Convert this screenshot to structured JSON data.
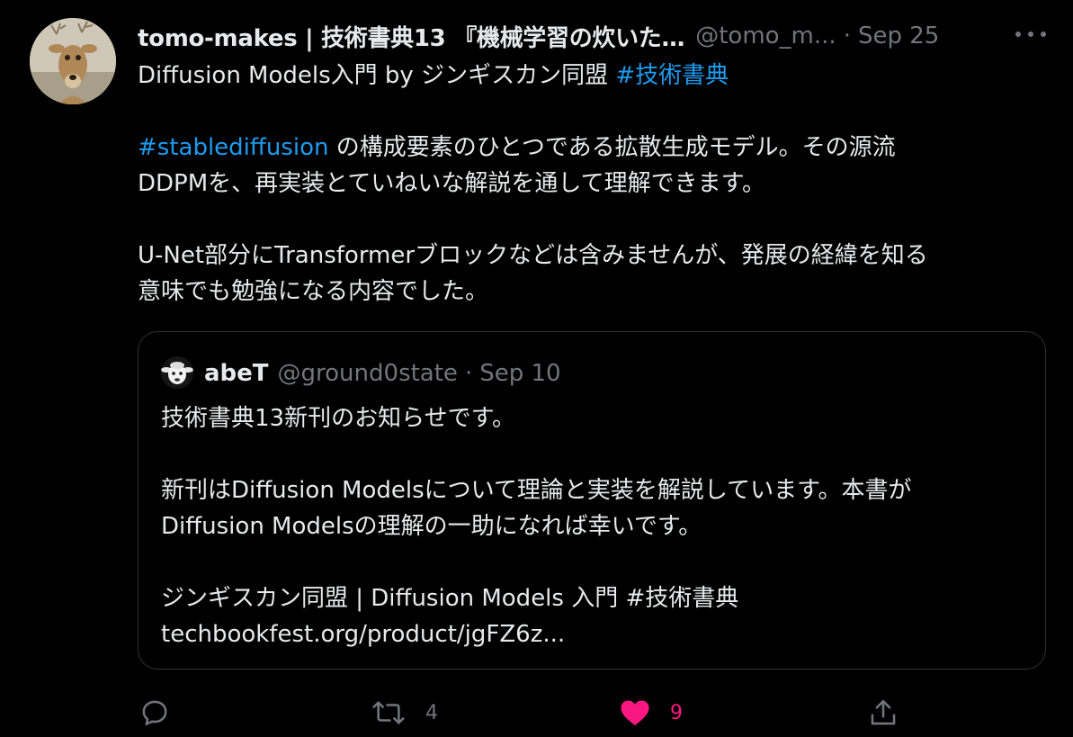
{
  "tweet": {
    "author": {
      "display_name": "tomo-makes | 技術書典13 『機械学習の炊いた…",
      "handle": "@tomo_m...",
      "date": "Sep 25",
      "separator": "·"
    },
    "line1_prefix": "Diffusion Models入門 by ジンギスカン同盟 ",
    "line1_hashtag": "#技術書典",
    "line3_hashtag": "#stablediffusion",
    "line3_rest": " の構成要素のひとつである拡散生成モデル。その源流",
    "line4": "DDPMを、再実装とていねいな解説を通して理解できます。",
    "line6": "U-Net部分にTransformerブロックなどは含みませんが、発展の経緯を知る",
    "line7": "意味でも勉強になる内容でした。"
  },
  "quote": {
    "display_name": "abeT",
    "handle": "@ground0state",
    "separator": "·",
    "date": "Sep 10",
    "lines": [
      "技術書典13新刊のお知らせです。",
      "",
      "新刊はDiffusion Modelsについて理論と実装を解説しています。本書が",
      "Diffusion Modelsの理解の一助になれば幸いです。",
      "",
      "ジンギスカン同盟 | Diffusion Models 入門 #技術書典",
      "techbookfest.org/product/jgFZ6z..."
    ]
  },
  "actions": {
    "reply_icon": "reply-icon",
    "retweet_icon": "retweet-icon",
    "retweet_count": "4",
    "like_icon": "heart-icon",
    "like_count": "9",
    "share_icon": "share-icon"
  },
  "colors": {
    "background": "#000000",
    "text": "#e7e9ea",
    "muted": "#71767b",
    "link": "#1d9bf0",
    "like": "#f91880",
    "border": "#2f3336"
  }
}
